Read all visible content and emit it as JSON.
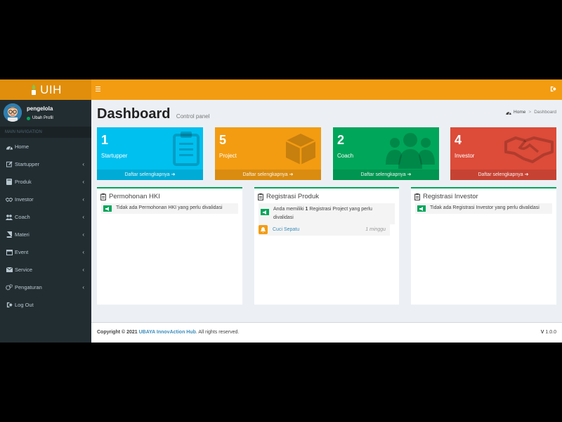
{
  "header": {
    "logo_text": "UIH"
  },
  "user": {
    "name": "pengelola",
    "status": "Ubah Profil"
  },
  "sidebar": {
    "nav_header": "MAIN NAVIGATION",
    "items": [
      {
        "label": "Home",
        "icon": "dashboard-icon"
      },
      {
        "label": "Startupper",
        "icon": "edit-icon"
      },
      {
        "label": "Produk",
        "icon": "book-icon"
      },
      {
        "label": "Investor",
        "icon": "handshake-icon"
      },
      {
        "label": "Coach",
        "icon": "users-icon"
      },
      {
        "label": "Materi",
        "icon": "book-icon"
      },
      {
        "label": "Event",
        "icon": "calendar-icon"
      },
      {
        "label": "Service",
        "icon": "envelope-icon"
      },
      {
        "label": "Pengaturan",
        "icon": "gears-icon"
      },
      {
        "label": "Log Out",
        "icon": "sign-out-icon"
      }
    ]
  },
  "page": {
    "title": "Dashboard",
    "subtitle": "Control panel"
  },
  "breadcrumb": {
    "home": "Home",
    "current": "Dashboard"
  },
  "stats": [
    {
      "count": "1",
      "label": "Startupper",
      "link": "Daftar selengkapnya",
      "color": "#00c0ef",
      "icon": "clipboard-icon"
    },
    {
      "count": "5",
      "label": "Project",
      "link": "Daftar selengkapnya",
      "color": "#f39c12",
      "icon": "cube-icon"
    },
    {
      "count": "2",
      "label": "Coach",
      "link": "Daftar selengkapnya",
      "color": "#00a65a",
      "icon": "users-icon"
    },
    {
      "count": "4",
      "label": "Investor",
      "link": "Daftar selengkapnya",
      "color": "#dd4b39",
      "icon": "handshake-icon"
    }
  ],
  "panels": {
    "hki": {
      "title": "Permohonan HKI",
      "alert": "Tidak ada Permohonan HKI yang perlu divalidasi"
    },
    "produk": {
      "title": "Registrasi Produk",
      "alert_pre": "Anda memiliki ",
      "alert_count": "1",
      "alert_post": " Registrasi Project yang perlu divalidasi",
      "item_name": "Cuci Sepatu",
      "item_time": "1 minggu"
    },
    "investor": {
      "title": "Registrasi Investor",
      "alert": "Tidak ada Registrasi Investor yang perlu divalidasi"
    }
  },
  "footer": {
    "copyright_prefix": "Copyright © 2021 ",
    "org": "UBAYA InnovAction Hub",
    "suffix": ". All rights reserved.",
    "version_label": "V",
    "version": "1.0.0"
  },
  "colors": {
    "brand": "#f39c12",
    "brand_dark": "#e08e0b",
    "sidebar": "#222d32",
    "panel_border": "#00a65a"
  }
}
